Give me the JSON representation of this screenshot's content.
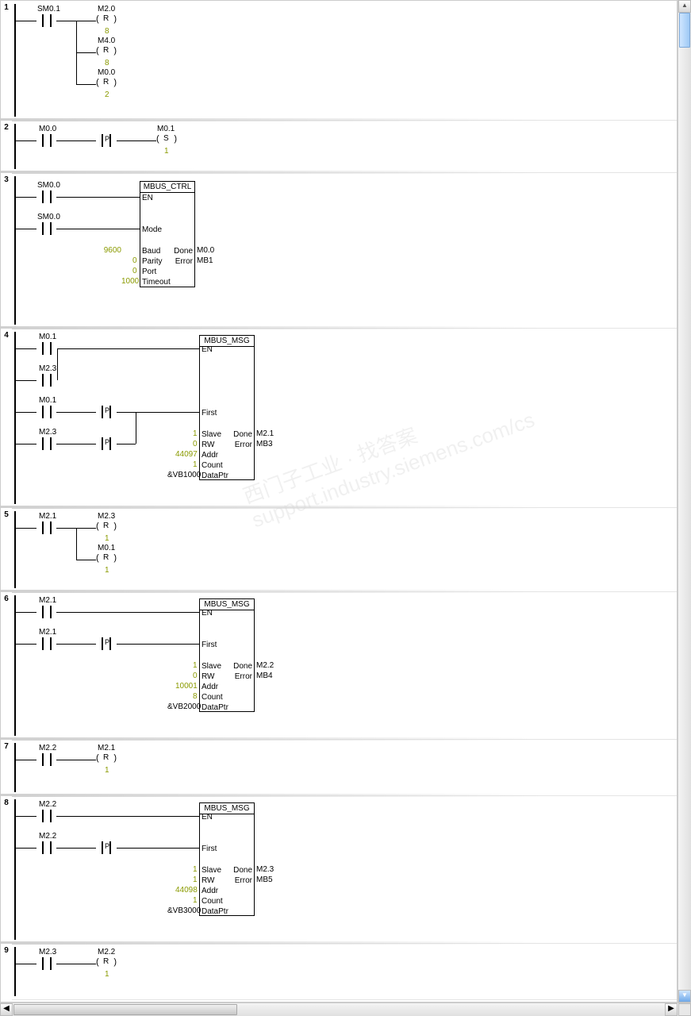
{
  "networks": {
    "n1": {
      "num": "1",
      "c1": "SM0.1",
      "coil1": {
        "addr": "M2.0",
        "op": "R",
        "n": "8"
      },
      "coil2": {
        "addr": "M4.0",
        "op": "R",
        "n": "8"
      },
      "coil3": {
        "addr": "M0.0",
        "op": "R",
        "n": "2"
      }
    },
    "n2": {
      "num": "2",
      "c1": "M0.0",
      "edge": "P",
      "coil1": {
        "addr": "M0.1",
        "op": "S",
        "n": "1"
      }
    },
    "n3": {
      "num": "3",
      "c1": "SM0.0",
      "c2": "SM0.0",
      "box": {
        "title": "MBUS_CTRL",
        "en": "EN",
        "mode": "Mode",
        "baud_l": "Baud",
        "baud_v": "9600",
        "parity_l": "Parity",
        "parity_v": "0",
        "port_l": "Port",
        "port_v": "0",
        "timeout_l": "Timeout",
        "timeout_v": "1000",
        "done_l": "Done",
        "done_v": "M0.0",
        "error_l": "Error",
        "error_v": "MB1"
      }
    },
    "n4": {
      "num": "4",
      "c1": "M0.1",
      "c2": "M2.3",
      "c3": "M0.1",
      "c4": "M2.3",
      "edge": "P",
      "box": {
        "title": "MBUS_MSG",
        "en": "EN",
        "first": "First",
        "slave_l": "Slave",
        "slave_v": "1",
        "rw_l": "RW",
        "rw_v": "0",
        "addr_l": "Addr",
        "addr_v": "44097",
        "count_l": "Count",
        "count_v": "1",
        "dp_l": "DataPtr",
        "dp_v": "&VB1000",
        "done_l": "Done",
        "done_v": "M2.1",
        "error_l": "Error",
        "error_v": "MB3"
      }
    },
    "n5": {
      "num": "5",
      "c1": "M2.1",
      "coil1": {
        "addr": "M2.3",
        "op": "R",
        "n": "1"
      },
      "coil2": {
        "addr": "M0.1",
        "op": "R",
        "n": "1"
      }
    },
    "n6": {
      "num": "6",
      "c1": "M2.1",
      "c2": "M2.1",
      "edge": "P",
      "box": {
        "title": "MBUS_MSG",
        "en": "EN",
        "first": "First",
        "slave_l": "Slave",
        "slave_v": "1",
        "rw_l": "RW",
        "rw_v": "0",
        "addr_l": "Addr",
        "addr_v": "10001",
        "count_l": "Count",
        "count_v": "8",
        "dp_l": "DataPtr",
        "dp_v": "&VB2000",
        "done_l": "Done",
        "done_v": "M2.2",
        "error_l": "Error",
        "error_v": "MB4"
      }
    },
    "n7": {
      "num": "7",
      "c1": "M2.2",
      "coil1": {
        "addr": "M2.1",
        "op": "R",
        "n": "1"
      }
    },
    "n8": {
      "num": "8",
      "c1": "M2.2",
      "c2": "M2.2",
      "edge": "P",
      "box": {
        "title": "MBUS_MSG",
        "en": "EN",
        "first": "First",
        "slave_l": "Slave",
        "slave_v": "1",
        "rw_l": "RW",
        "rw_v": "1",
        "addr_l": "Addr",
        "addr_v": "44098",
        "count_l": "Count",
        "count_v": "1",
        "dp_l": "DataPtr",
        "dp_v": "&VB3000",
        "done_l": "Done",
        "done_v": "M2.3",
        "error_l": "Error",
        "error_v": "MB5"
      }
    },
    "n9": {
      "num": "9",
      "c1": "M2.3",
      "coil1": {
        "addr": "M2.2",
        "op": "R",
        "n": "1"
      }
    }
  }
}
